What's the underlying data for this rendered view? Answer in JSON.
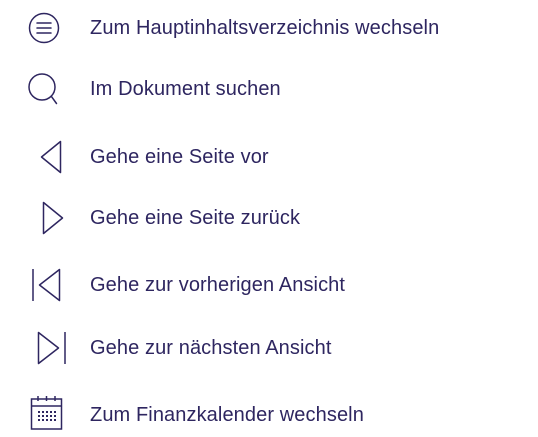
{
  "nav": {
    "accent": "#2e2660",
    "items": [
      {
        "icon": "menu-circle-icon",
        "label": "Zum Hauptinhaltsverzeichnis wechseln"
      },
      {
        "icon": "search-icon",
        "label": "Im Dokument suchen"
      },
      {
        "icon": "chevron-left-icon",
        "label": "Gehe eine Seite vor"
      },
      {
        "icon": "chevron-right-icon",
        "label": "Gehe eine Seite zurück"
      },
      {
        "icon": "skip-back-icon",
        "label": "Gehe zur vorherigen Ansicht"
      },
      {
        "icon": "skip-forward-icon",
        "label": "Gehe zur nächsten Ansicht"
      },
      {
        "icon": "calendar-icon",
        "label": "Zum Finanzkalender wechseln"
      }
    ]
  }
}
